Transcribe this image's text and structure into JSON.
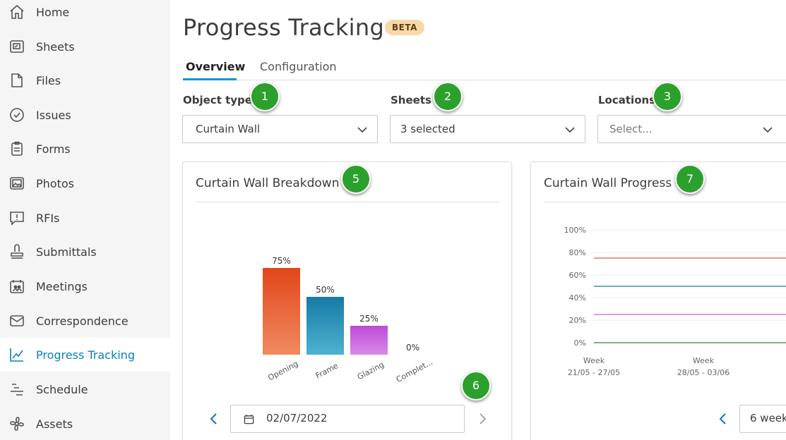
{
  "sidebar": {
    "items": [
      {
        "label": "Home",
        "icon": "home-icon"
      },
      {
        "label": "Sheets",
        "icon": "sheets-icon"
      },
      {
        "label": "Files",
        "icon": "files-icon"
      },
      {
        "label": "Issues",
        "icon": "issues-icon"
      },
      {
        "label": "Forms",
        "icon": "forms-icon"
      },
      {
        "label": "Photos",
        "icon": "photos-icon"
      },
      {
        "label": "RFIs",
        "icon": "rfis-icon"
      },
      {
        "label": "Submittals",
        "icon": "submittals-icon"
      },
      {
        "label": "Meetings",
        "icon": "meetings-icon"
      },
      {
        "label": "Correspondence",
        "icon": "correspondence-icon"
      },
      {
        "label": "Progress Tracking",
        "icon": "progress-tracking-icon",
        "active": true
      },
      {
        "label": "Schedule",
        "icon": "schedule-icon"
      },
      {
        "label": "Assets",
        "icon": "assets-icon"
      }
    ]
  },
  "header": {
    "title": "Progress Tracking",
    "badge": "BETA"
  },
  "tabs": [
    {
      "label": "Overview",
      "active": true
    },
    {
      "label": "Configuration",
      "active": false
    }
  ],
  "filters": {
    "object_type": {
      "label": "Object type",
      "value": "Curtain Wall"
    },
    "sheets": {
      "label": "Sheets",
      "value": "3 selected"
    },
    "locations": {
      "label": "Locations",
      "placeholder": "Select..."
    }
  },
  "callouts": [
    "1",
    "2",
    "3",
    "5",
    "6",
    "7"
  ],
  "breakdown_card": {
    "title": "Curtain Wall Breakdown",
    "date": "02/07/2022"
  },
  "progress_card": {
    "title": "Curtain Wall Progress",
    "period": "6 week"
  },
  "colors": {
    "accent": "#0696d7",
    "active_text": "#0a7fc0",
    "callout": "#2ca02c",
    "opening": "#e2461a",
    "frame": "#167ba6",
    "glazing": "#bc4ad6",
    "line_orange": "#e8735a",
    "line_blue": "#3399b8",
    "line_purple": "#d07ae0",
    "line_green": "#4f9a4f"
  },
  "chart_data": [
    {
      "type": "bar",
      "categories": [
        "Opening",
        "Frame",
        "Glazing",
        "Complet..."
      ],
      "values": [
        75,
        50,
        25,
        0
      ],
      "value_labels": [
        "75%",
        "50%",
        "25%",
        "0%"
      ],
      "ylim": [
        0,
        100
      ]
    },
    {
      "type": "line",
      "x": [
        "Week\n21/05 - 27/05",
        "Week\n28/05 - 03/06"
      ],
      "x_ticks": [
        {
          "line1": "Week",
          "line2": "21/05 - 27/05"
        },
        {
          "line1": "Week",
          "line2": "28/05 - 03/06"
        }
      ],
      "y_ticks": [
        "100%",
        "80%",
        "60%",
        "40%",
        "20%",
        "0%"
      ],
      "ylim": [
        0,
        100
      ],
      "series": [
        {
          "color": "#e8735a",
          "values": [
            75,
            75
          ]
        },
        {
          "color": "#3399b8",
          "values": [
            50,
            50
          ]
        },
        {
          "color": "#d07ae0",
          "values": [
            25,
            25
          ]
        },
        {
          "color": "#4f9a4f",
          "values": [
            0,
            0
          ]
        }
      ]
    }
  ]
}
